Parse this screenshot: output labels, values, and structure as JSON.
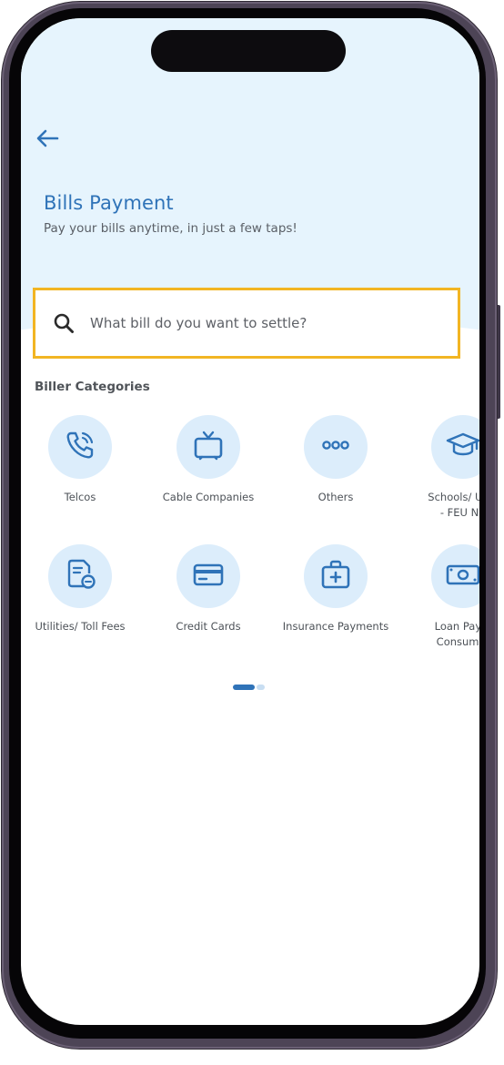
{
  "header": {
    "back_icon": "arrow-left-icon",
    "title": "Bills Payment",
    "subtitle": "Pay your bills anytime, in just a few taps!"
  },
  "search": {
    "icon": "search-icon",
    "placeholder": "What bill do you want to settle?",
    "value": ""
  },
  "section": {
    "title": "Biller Categories"
  },
  "categories": [
    {
      "label": "Telcos",
      "icon": "phone-call-icon"
    },
    {
      "label": "Cable Companies",
      "icon": "tv-icon"
    },
    {
      "label": "Others",
      "icon": "more-dots-icon"
    },
    {
      "label": "Schools/ Univ\n- FEU NR",
      "icon": "graduation-cap-icon"
    },
    {
      "label": "Utilities/ Toll Fees",
      "icon": "utility-bill-icon"
    },
    {
      "label": "Credit Cards",
      "icon": "credit-card-icon"
    },
    {
      "label": "Insurance Payments",
      "icon": "medical-kit-icon"
    },
    {
      "label": "Loan Paym\nConsumer",
      "icon": "cash-icon"
    }
  ],
  "pagination": {
    "pages": 2,
    "current": 1
  },
  "colors": {
    "accent": "#2f73b8",
    "hero_bg": "#e6f4fd",
    "icon_circle": "#dcedfb",
    "search_border": "#f2b523"
  }
}
